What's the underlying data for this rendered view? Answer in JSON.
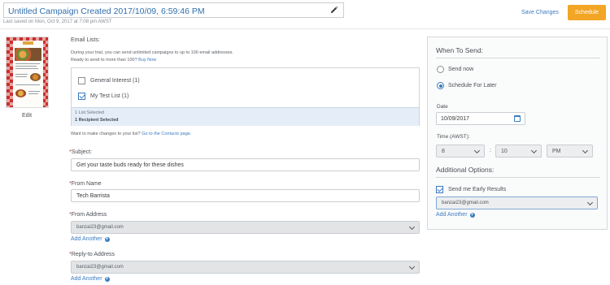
{
  "header": {
    "title": "Untitled Campaign Created 2017/10/09, 6:59:46 PM",
    "last_saved": "Last saved on Mon, Oct 9, 2017 at 7:08 pm AWST",
    "save_changes": "Save Changes",
    "schedule": "Schedule"
  },
  "thumbnail": {
    "edit_label": "Edit"
  },
  "email_lists": {
    "label": "Email Lists:",
    "trial_note": "During your trial, you can send unlimited campaigns to up to 100 email addresses.",
    "ready_note": "Ready to send to more than 100?",
    "buy_now": "Buy Now",
    "lists": [
      {
        "name": "General Interest (1)",
        "checked": false
      },
      {
        "name": "My Test List (1)",
        "checked": true
      }
    ],
    "selected_summary": "1 List Selected",
    "recipient_summary": "1 Recipient Selected",
    "change_note": "Want to make changes to your list?",
    "contacts_link": "Go to the Contacts page."
  },
  "subject": {
    "label": "Subject:",
    "value": "Get your taste buds ready for these dishes"
  },
  "from_name": {
    "label": "From Name",
    "value": "Tech Barrista"
  },
  "from_address": {
    "label": "From Address",
    "value": "banzai23@gmail.com",
    "add_another": "Add Another"
  },
  "reply_to": {
    "label": "Reply-to Address",
    "value": "banzai23@gmail.com",
    "add_another": "Add Another"
  },
  "when_to_send": {
    "title": "When To Send:",
    "options": [
      {
        "label": "Send now",
        "selected": false
      },
      {
        "label": "Schedule For Later",
        "selected": true
      }
    ],
    "date_label": "Date",
    "date_value": "10/09/2017",
    "time_label": "Time (AWST):",
    "hour": "8",
    "minute": "10",
    "ampm": "PM",
    "separator": ":"
  },
  "additional_options": {
    "title": "Additional Options:",
    "early_results_label": "Send me Early Results",
    "early_results_checked": true,
    "early_results_email": "banzai23@gmail.com",
    "add_another": "Add Another"
  },
  "colors": {
    "accent": "#3b7bbf",
    "schedule_button": "#f3a525"
  }
}
